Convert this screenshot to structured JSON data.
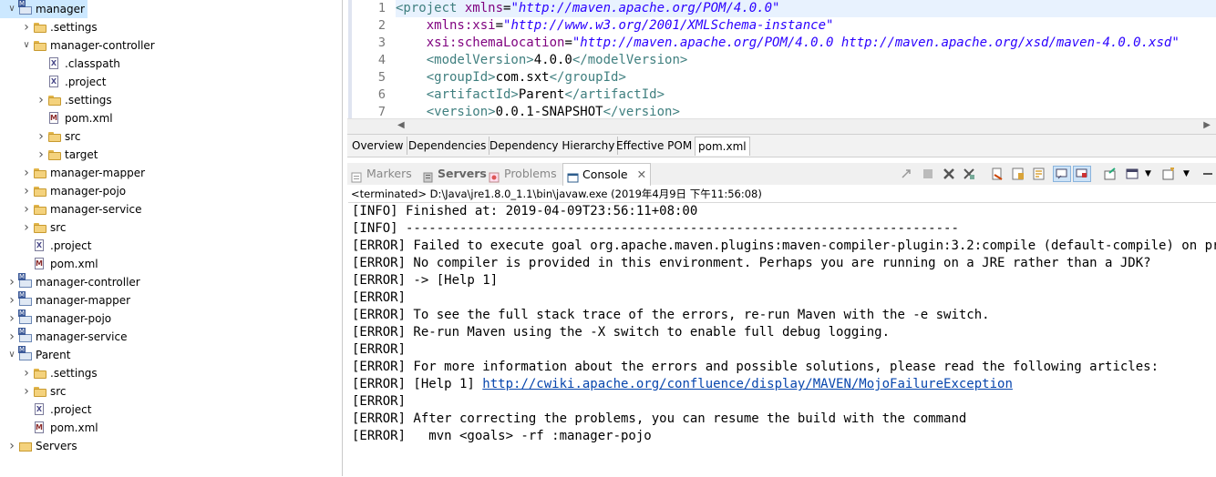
{
  "tree": [
    {
      "label": "manager",
      "icon": "maven-project-icon",
      "twisty": "open",
      "indent": 0,
      "selected": true
    },
    {
      "label": ".settings",
      "icon": "folder-icon",
      "twisty": "closed",
      "indent": 1
    },
    {
      "label": "manager-controller",
      "icon": "folder-icon",
      "twisty": "open",
      "indent": 1
    },
    {
      "label": ".classpath",
      "icon": "xml-file-icon",
      "twisty": "",
      "indent": 2
    },
    {
      "label": ".project",
      "icon": "xml-file-icon",
      "twisty": "",
      "indent": 2
    },
    {
      "label": ".settings",
      "icon": "folder-icon",
      "twisty": "closed",
      "indent": 2
    },
    {
      "label": "pom.xml",
      "icon": "pom-file-icon",
      "twisty": "",
      "indent": 2
    },
    {
      "label": "src",
      "icon": "folder-icon",
      "twisty": "closed",
      "indent": 2
    },
    {
      "label": "target",
      "icon": "folder-icon",
      "twisty": "closed",
      "indent": 2
    },
    {
      "label": "manager-mapper",
      "icon": "folder-icon",
      "twisty": "closed",
      "indent": 1
    },
    {
      "label": "manager-pojo",
      "icon": "folder-icon",
      "twisty": "closed",
      "indent": 1
    },
    {
      "label": "manager-service",
      "icon": "folder-icon",
      "twisty": "closed",
      "indent": 1
    },
    {
      "label": "src",
      "icon": "folder-icon",
      "twisty": "closed",
      "indent": 1
    },
    {
      "label": ".project",
      "icon": "xml-file-icon",
      "twisty": "",
      "indent": 1
    },
    {
      "label": "pom.xml",
      "icon": "pom-file-icon",
      "twisty": "",
      "indent": 1
    },
    {
      "label": "manager-controller",
      "icon": "maven-project-icon",
      "twisty": "closed",
      "indent": 0
    },
    {
      "label": "manager-mapper",
      "icon": "maven-project-icon",
      "twisty": "closed",
      "indent": 0
    },
    {
      "label": "manager-pojo",
      "icon": "maven-project-icon",
      "twisty": "closed",
      "indent": 0
    },
    {
      "label": "manager-service",
      "icon": "maven-project-icon",
      "twisty": "closed",
      "indent": 0
    },
    {
      "label": "Parent",
      "icon": "maven-project-icon",
      "twisty": "open",
      "indent": 0
    },
    {
      "label": ".settings",
      "icon": "folder-icon",
      "twisty": "closed",
      "indent": 1
    },
    {
      "label": "src",
      "icon": "folder-icon",
      "twisty": "closed",
      "indent": 1
    },
    {
      "label": ".project",
      "icon": "xml-file-icon",
      "twisty": "",
      "indent": 1
    },
    {
      "label": "pom.xml",
      "icon": "pom-file-icon",
      "twisty": "",
      "indent": 1
    },
    {
      "label": "Servers",
      "icon": "servers-folder-icon",
      "twisty": "closed",
      "indent": 0
    }
  ],
  "editor": {
    "line_numbers": [
      "1",
      "2",
      "3",
      "4",
      "5",
      "6",
      "7"
    ],
    "lines": [
      [
        {
          "t": "<project ",
          "c": "tag"
        },
        {
          "t": "xmlns",
          "c": "attr"
        },
        {
          "t": "=",
          "c": "txt"
        },
        {
          "t": "\"http://maven.apache.org/POM/4.0.0\"",
          "c": "val"
        }
      ],
      [
        {
          "t": "    xmlns:xsi",
          "c": "attr"
        },
        {
          "t": "=",
          "c": "txt"
        },
        {
          "t": "\"http://www.w3.org/2001/XMLSchema-instance\"",
          "c": "val"
        }
      ],
      [
        {
          "t": "    xsi:schemaLocation",
          "c": "attr"
        },
        {
          "t": "=",
          "c": "txt"
        },
        {
          "t": "\"http://maven.apache.org/POM/4.0.0 http://maven.apache.org/xsd/maven-4.0.0.xsd\"",
          "c": "val"
        }
      ],
      [
        {
          "t": "    <modelVersion>",
          "c": "tag"
        },
        {
          "t": "4.0.0",
          "c": "txt"
        },
        {
          "t": "</modelVersion>",
          "c": "tag"
        }
      ],
      [
        {
          "t": "    <groupId>",
          "c": "tag"
        },
        {
          "t": "com.sxt",
          "c": "txt"
        },
        {
          "t": "</groupId>",
          "c": "tag"
        }
      ],
      [
        {
          "t": "    <artifactId>",
          "c": "tag"
        },
        {
          "t": "Parent",
          "c": "txt"
        },
        {
          "t": "</artifactId>",
          "c": "tag"
        }
      ],
      [
        {
          "t": "    <version>",
          "c": "tag"
        },
        {
          "t": "0.0.1-SNAPSHOT",
          "c": "txt"
        },
        {
          "t": "</version>",
          "c": "tag"
        }
      ]
    ]
  },
  "editor_tabs": [
    "Overview",
    "Dependencies",
    "Dependency Hierarchy",
    "Effective POM",
    "pom.xml"
  ],
  "view_tabs": {
    "markers": "Markers",
    "servers": "Servers",
    "problems": "Problems",
    "console": "Console"
  },
  "console": {
    "terminated": "<terminated> D:\\Java\\jre1.8.0_1.1\\bin\\javaw.exe (2019年4月9日 下午11:56:08)",
    "lines": [
      "[INFO] Finished at: 2019-04-09T23:56:11+08:00",
      "[INFO] ------------------------------------------------------------------------",
      "[ERROR] Failed to execute goal org.apache.maven.plugins:maven-compiler-plugin:3.2:compile (default-compile) on project manager-pojo: Compilation failure",
      "[ERROR] No compiler is provided in this environment. Perhaps you are running on a JRE rather than a JDK?",
      "[ERROR] -> [Help 1]",
      "[ERROR]",
      "[ERROR] To see the full stack trace of the errors, re-run Maven with the -e switch.",
      "[ERROR] Re-run Maven using the -X switch to enable full debug logging.",
      "[ERROR]",
      "[ERROR] For more information about the errors and possible solutions, please read the following articles:",
      "[ERROR] [Help 1] ",
      "[ERROR]",
      "[ERROR] After correcting the problems, you can resume the build with the command",
      "[ERROR]   mvn <goals> -rf :manager-pojo"
    ],
    "help_link": "http://cwiki.apache.org/confluence/display/MAVEN/MojoFailureException"
  },
  "colors": {
    "xml_tag": "#3f7f7f",
    "xml_attr": "#7f007f",
    "xml_value": "#2a00ff",
    "link": "#0645ad"
  }
}
